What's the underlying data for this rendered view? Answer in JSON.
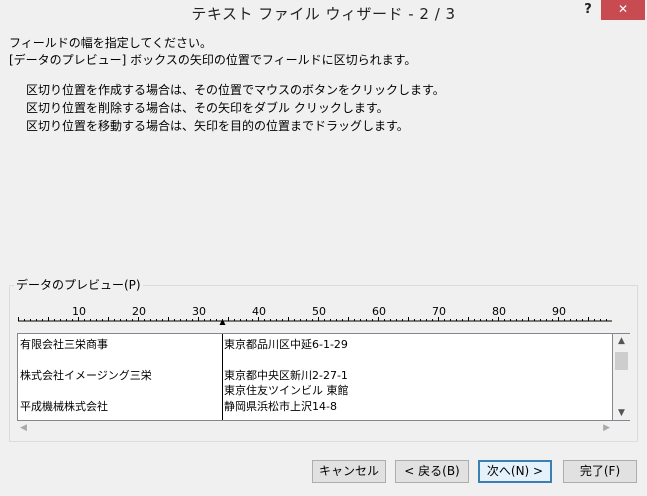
{
  "window": {
    "title": "テキスト ファイル ウィザード - 2 / 3",
    "help_label": "?",
    "close_label": "✕"
  },
  "instructions": {
    "line1": "フィールドの幅を指定してください。",
    "line2": "[データのプレビュー] ボックスの矢印の位置でフィールドに区切られます。",
    "line3": "区切り位置を作成する場合は、その位置でマウスのボタンをクリックします。",
    "line4": "区切り位置を削除する場合は、その矢印をダブル クリックします。",
    "line5": "区切り位置を移動する場合は、矢印を目的の位置までドラッグします。"
  },
  "preview": {
    "label": "データのプレビュー(P)",
    "ruler_ticks": [
      "10",
      "20",
      "30",
      "40",
      "50",
      "60",
      "70",
      "80",
      "90"
    ],
    "break_column": 34,
    "rows": [
      {
        "col1": "有限会社三栄商事",
        "col2": "東京都品川区中延6-1-29"
      },
      {
        "col1": "",
        "col2": ""
      },
      {
        "col1": "株式会社イメージング三栄",
        "col2": "東京都中央区新川2-27-1"
      },
      {
        "col1": "",
        "col2": "東京住友ツインビル 東館"
      },
      {
        "col1": "平成機械株式会社",
        "col2": "静岡県浜松市上沢14-8"
      }
    ]
  },
  "buttons": {
    "cancel": "キャンセル",
    "back": "< 戻る(B)",
    "next": "次へ(N) >",
    "finish": "完了(F)"
  }
}
